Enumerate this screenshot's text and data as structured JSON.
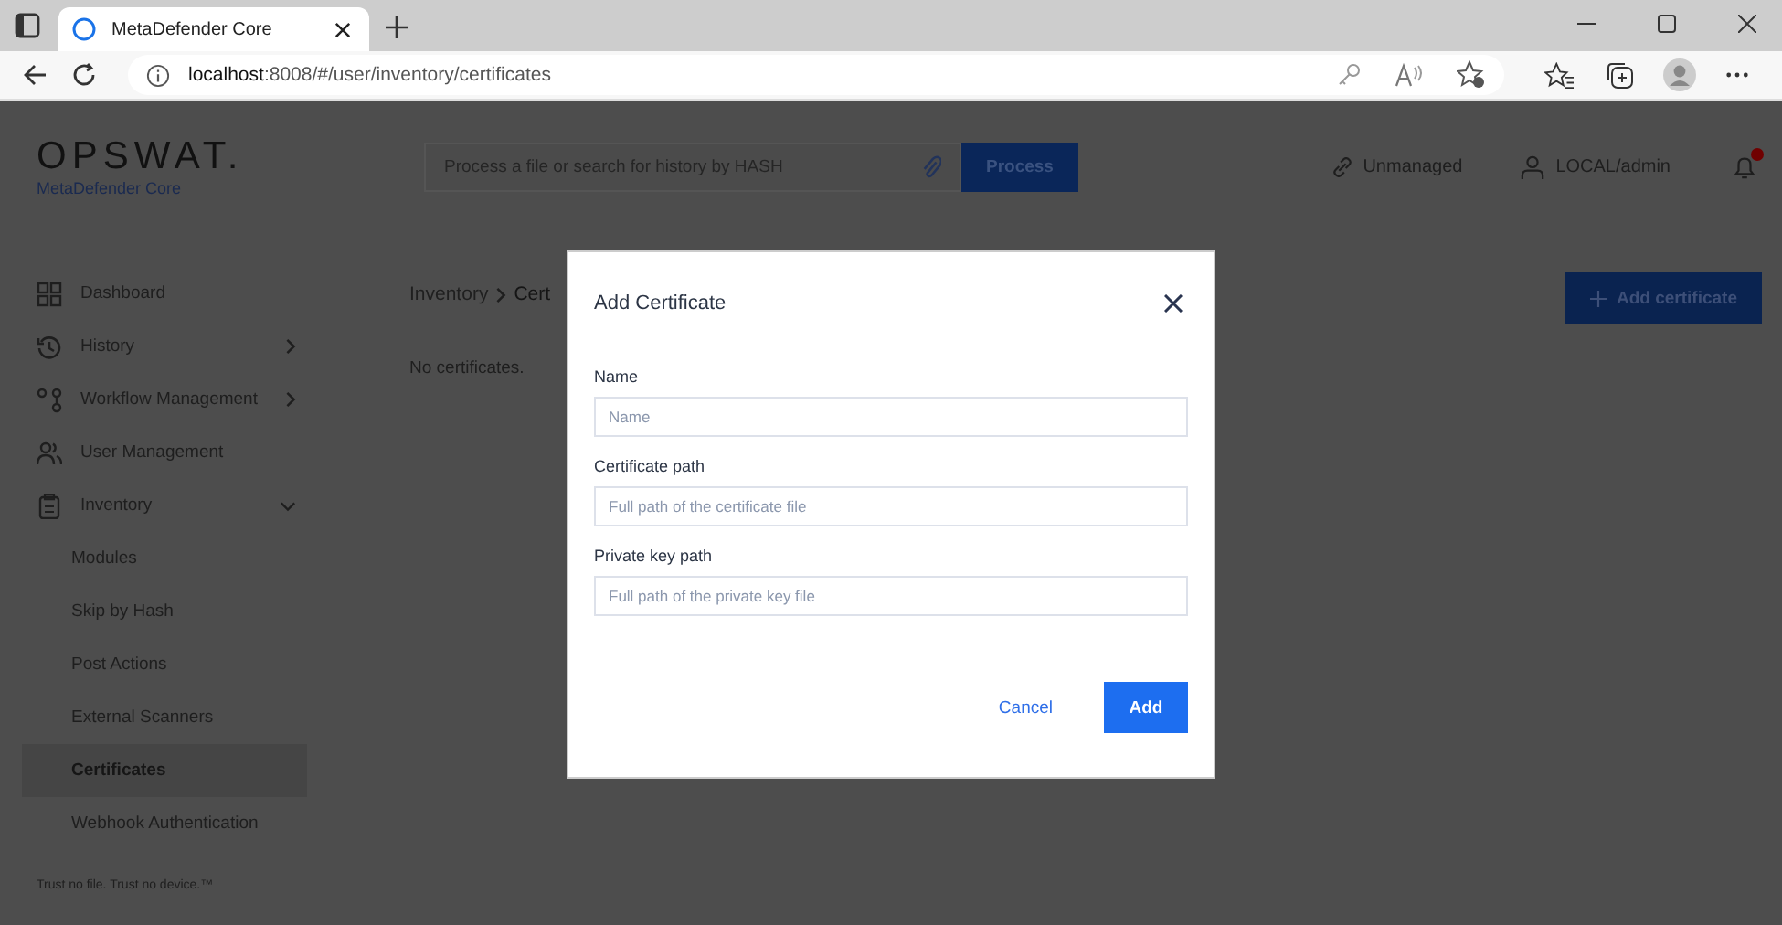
{
  "browser": {
    "tab_title": "MetaDefender Core",
    "url_host": "localhost",
    "url_rest": ":8008/#/user/inventory/certificates"
  },
  "header": {
    "logo": "OPSWAT.",
    "product": "MetaDefender Core",
    "search": {
      "placeholder": "Process a file or search for history by HASH"
    },
    "process_button": "Process",
    "status": "Unmanaged",
    "user": "LOCAL/admin",
    "notification_dot": true
  },
  "sidebar": {
    "items": [
      {
        "kind": "link",
        "label": "Dashboard",
        "selected": false
      },
      {
        "kind": "group",
        "label": "History",
        "expanded": false,
        "selected": false
      },
      {
        "kind": "group",
        "label": "Workflow Management",
        "expanded": false,
        "selected": false
      },
      {
        "kind": "link",
        "label": "User Management",
        "selected": false
      },
      {
        "kind": "group",
        "label": "Inventory",
        "expanded": true,
        "selected": false,
        "children": [
          {
            "label": "Modules",
            "selected": false
          },
          {
            "label": "Skip by Hash",
            "selected": false
          },
          {
            "label": "Post Actions",
            "selected": false
          },
          {
            "label": "External Scanners",
            "selected": false
          },
          {
            "label": "Certificates",
            "selected": true
          },
          {
            "label": "Webhook Authentication",
            "selected": false
          }
        ]
      }
    ],
    "footer": "Trust no file. Trust no device.™"
  },
  "main": {
    "breadcrumb": [
      "Inventory",
      "Cert"
    ],
    "add_button": "Add certificate",
    "empty_text": "No certificates."
  },
  "dialog": {
    "title": "Add Certificate",
    "fields": [
      {
        "label": "Name",
        "placeholder": "Name"
      },
      {
        "label": "Certificate path",
        "placeholder": "Full path of the certificate file"
      },
      {
        "label": "Private key path",
        "placeholder": "Full path of the private key file"
      }
    ],
    "buttons": [
      {
        "kind": "secondary",
        "label": "Cancel"
      },
      {
        "kind": "primary",
        "label": "Add"
      }
    ]
  }
}
